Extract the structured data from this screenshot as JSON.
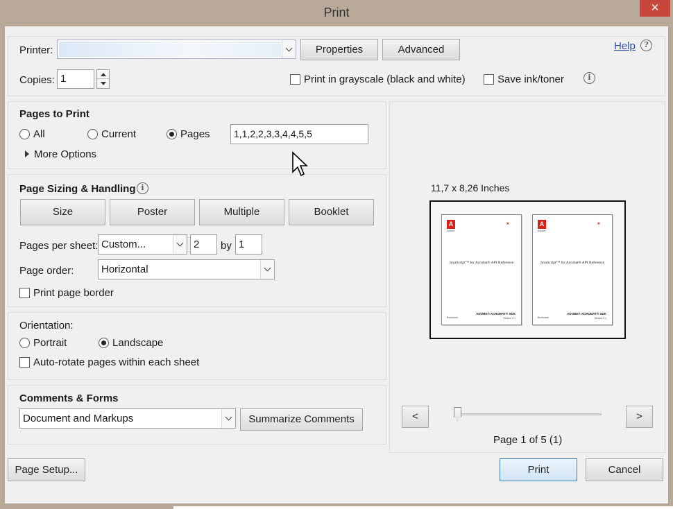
{
  "window": {
    "title": "Print",
    "close_glyph": "✕"
  },
  "printer": {
    "label": "Printer:",
    "value": "",
    "properties_label": "Properties",
    "advanced_label": "Advanced"
  },
  "help": {
    "label": "Help",
    "icon": "help-circle-icon",
    "help_glyph": "?"
  },
  "copies": {
    "label": "Copies:",
    "value": "1"
  },
  "options": {
    "grayscale_label": "Print in grayscale (black and white)",
    "grayscale_checked": false,
    "save_ink_label": "Save ink/toner",
    "save_ink_checked": false,
    "info_glyph": "i"
  },
  "pages_to_print": {
    "heading": "Pages to Print",
    "all_label": "All",
    "current_label": "Current",
    "pages_label": "Pages",
    "selected": "Pages",
    "pages_value": "1,1,2,2,3,3,4,4,5,5",
    "more_options_label": "More Options"
  },
  "sizing": {
    "heading": "Page Sizing & Handling",
    "info_glyph": "i",
    "size_label": "Size",
    "poster_label": "Poster",
    "multiple_label": "Multiple",
    "booklet_label": "Booklet",
    "pages_per_sheet_label": "Pages per sheet:",
    "pages_per_sheet_value": "Custom...",
    "cols_value": "2",
    "by_label": "by",
    "rows_value": "1",
    "page_order_label": "Page order:",
    "page_order_value": "Horizontal",
    "print_border_label": "Print page border",
    "print_border_checked": false
  },
  "orientation": {
    "heading": "Orientation:",
    "portrait_label": "Portrait",
    "landscape_label": "Landscape",
    "selected": "Landscape",
    "auto_rotate_label": "Auto-rotate pages within each sheet",
    "auto_rotate_checked": false
  },
  "comments": {
    "heading": "Comments & Forms",
    "value": "Document and Markups",
    "summarize_label": "Summarize Comments"
  },
  "preview": {
    "paper_size": "11,7 x 8,26 Inches",
    "pages": [
      {
        "heading": "JavaScript™ for Acrobat® API Reference",
        "footer": "ADOBE® ACROBAT® SDK",
        "version": "Version 9.1",
        "left_note": "Bookmark",
        "brand": "Adobe",
        "logo_glyph": "A",
        "logo2_glyph": "✴"
      },
      {
        "heading": "JavaScript™ for Acrobat® API Reference",
        "footer": "ADOBE® ACROBAT® SDK",
        "version": "Version 9.1",
        "left_note": "Bookmark",
        "brand": "Adobe",
        "logo_glyph": "A",
        "logo2_glyph": "✴"
      }
    ],
    "prev_label": "<",
    "next_label": ">",
    "page_status": "Page 1 of 5 (1)",
    "slider_position": 0.0
  },
  "footer": {
    "page_setup_label": "Page Setup...",
    "print_label": "Print",
    "cancel_label": "Cancel"
  },
  "colors": {
    "title_bar": "#b8a998",
    "close_button": "#c7463c",
    "dialog_bg": "#f0f0f0",
    "link": "#2b4fb3",
    "print_button_border": "#3c7fb1"
  }
}
